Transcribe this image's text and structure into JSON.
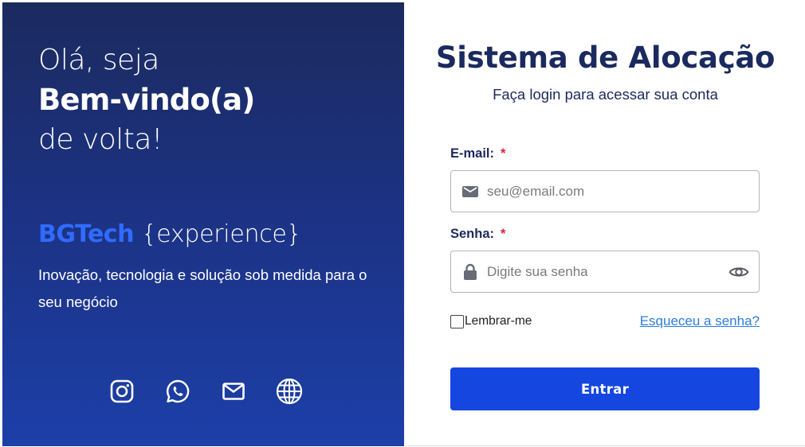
{
  "welcome": {
    "line1": "Olá, seja",
    "line2": "Bem-vindo(a)",
    "line3": "de volta!"
  },
  "brand": {
    "name": "BGTech",
    "tag": "{experience}",
    "name_color": "#2f6bff"
  },
  "tagline": "Inovação, tecnologia e solução sob medida para o seu negócio",
  "socials": [
    {
      "icon": "instagram-icon"
    },
    {
      "icon": "whatsapp-icon"
    },
    {
      "icon": "mail-icon"
    },
    {
      "icon": "globe-icon"
    }
  ],
  "login": {
    "title": "Sistema de Alocação",
    "subtitle": "Faça login para acessar sua conta",
    "email": {
      "label": "E-mail:",
      "required_mark": "*",
      "placeholder": "seu@email.com",
      "value": "",
      "icon": "mail-icon"
    },
    "password": {
      "label": "Senha:",
      "required_mark": "*",
      "placeholder": "Digite sua senha",
      "value": "",
      "icon": "lock-icon",
      "toggle_icon": "eye-icon"
    },
    "remember_label": "Lembrar-me",
    "remember_checked": false,
    "forgot_link": "Esqueceu a senha?",
    "submit_label": "Entrar"
  },
  "colors": {
    "panel_gradient_top": "#1b2a5e",
    "panel_gradient_bottom": "#1c3fa8",
    "primary_button": "#1546e0",
    "title_color": "#1b2a5e",
    "required": "#e0232e",
    "link": "#2d7de0"
  }
}
